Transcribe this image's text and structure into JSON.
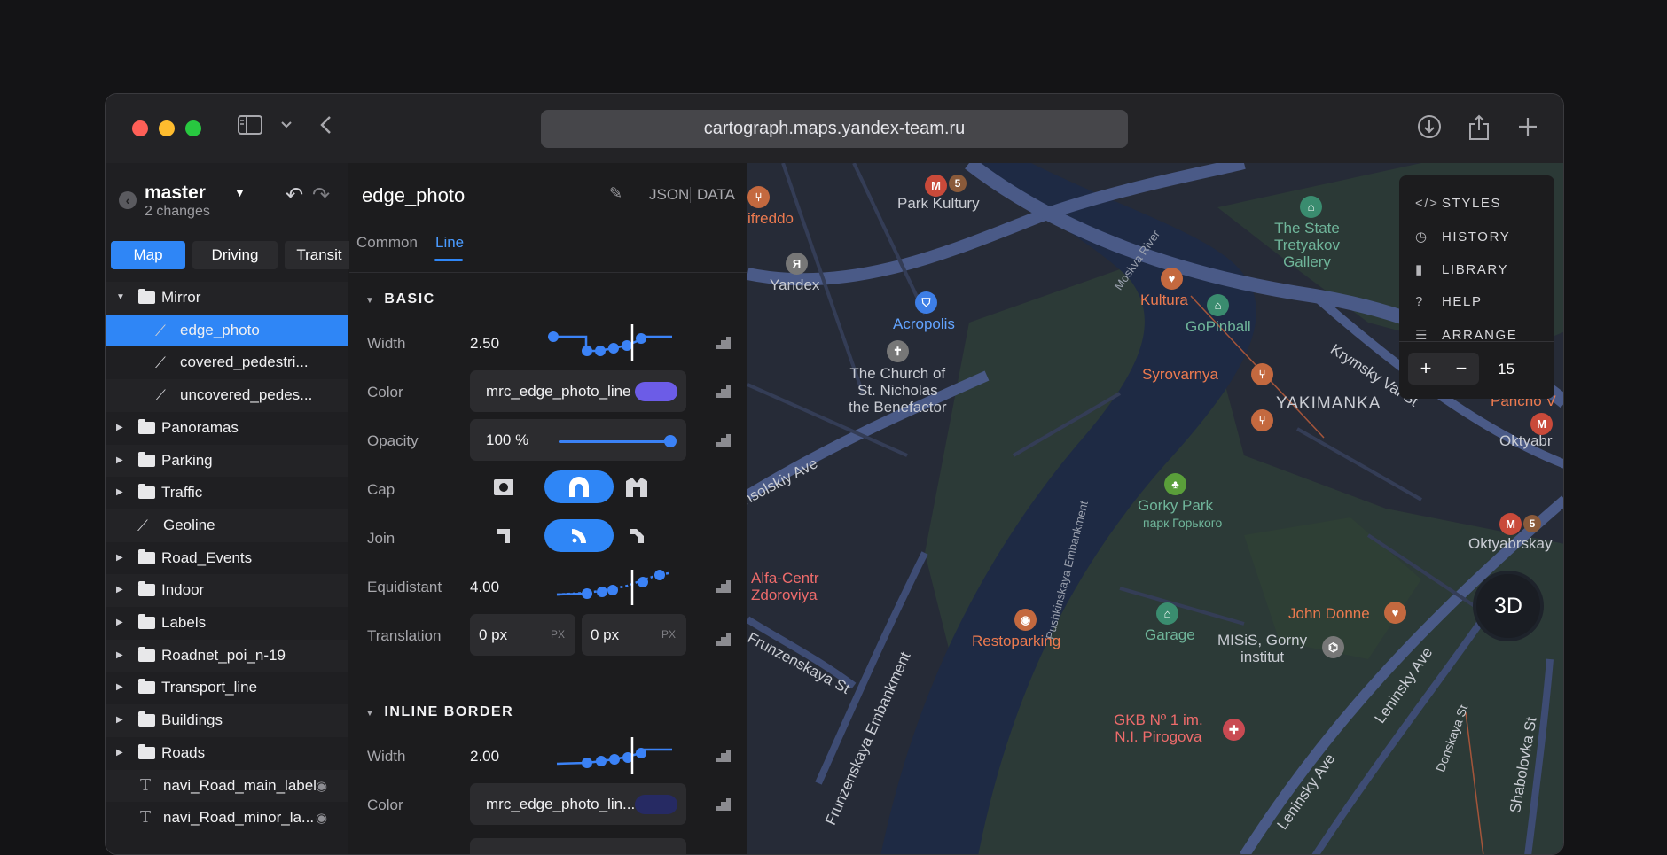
{
  "browser": {
    "url": "cartograph.maps.yandex-team.ru"
  },
  "sidebar": {
    "branch": "master",
    "changes": "2 changes",
    "tabs": [
      "Map",
      "Driving",
      "Transit"
    ],
    "layers": [
      {
        "label": "Mirror",
        "type": "folder"
      },
      {
        "label": "edge_photo",
        "type": "line"
      },
      {
        "label": "covered_pedestri...",
        "type": "line"
      },
      {
        "label": "uncovered_pedes...",
        "type": "line"
      },
      {
        "label": "Panoramas",
        "type": "folder"
      },
      {
        "label": "Parking",
        "type": "folder"
      },
      {
        "label": "Traffic",
        "type": "folder"
      },
      {
        "label": "Geoline",
        "type": "line"
      },
      {
        "label": "Road_Events",
        "type": "folder"
      },
      {
        "label": "Indoor",
        "type": "folder"
      },
      {
        "label": "Labels",
        "type": "folder"
      },
      {
        "label": "Roadnet_poi_n-19",
        "type": "folder"
      },
      {
        "label": "Transport_line",
        "type": "folder"
      },
      {
        "label": "Buildings",
        "type": "folder"
      },
      {
        "label": "Roads",
        "type": "folder"
      },
      {
        "label": "navi_Road_main_label",
        "type": "text"
      },
      {
        "label": "navi_Road_minor_la...",
        "type": "text"
      }
    ]
  },
  "editor": {
    "title": "edge_photo",
    "json_label": "JSON",
    "data_label": "DATA",
    "tabs": [
      "Common",
      "Line"
    ],
    "basic": {
      "heading": "BASIC",
      "width_label": "Width",
      "width_value": "2.50",
      "color_label": "Color",
      "color_value": "mrc_edge_photo_line",
      "color_swatch": "#6c5ce7",
      "opacity_label": "Opacity",
      "opacity_value": "100 %",
      "opacity_level": 1.0,
      "cap_label": "Cap",
      "join_label": "Join",
      "equidistant_label": "Equidistant",
      "equidistant_value": "4.00",
      "translation_label": "Translation",
      "translation_x": "0 px",
      "translation_y": "0 px",
      "unit": "PX"
    },
    "inline_border": {
      "heading": "INLINE BORDER",
      "width_label": "Width",
      "width_value": "2.00",
      "color_label": "Color",
      "color_value": "mrc_edge_photo_lin...",
      "color_swatch": "#262a63"
    }
  },
  "map": {
    "menu": [
      "STYLES",
      "HISTORY",
      "LIBRARY",
      "HELP",
      "ARRANGE"
    ],
    "zoom": "15",
    "button_3d": "3D",
    "labels": {
      "park_kultury": "Park Kultury",
      "metro5": "5",
      "metro_m": "M",
      "ifreddo": "ifreddo",
      "yandex": "Yandex",
      "acropolis": "Acropolis",
      "church": "The Church of\nSt. Nicholas\nthe Benefactor",
      "kultura": "Kultura",
      "gopinball": "GoPinball",
      "tretyakov": "The State\nTretyakov\nGallery",
      "syrovarnya": "Syrovarnya",
      "yakimanka": "YAKIMANKA",
      "gorky_park": "Gorky Park",
      "gorky_park_ru": "парк Горького",
      "pancho": "Pancho V",
      "oktyabr": "Oktyabr",
      "oktyabrskaya": "Oktyabrskay",
      "alfa": "Alfa-Centr\nZdoroviya",
      "restoparking": "Restoparking",
      "garage": "Garage",
      "john_donne": "John Donne",
      "misis": "MISiS, Gorny\ninstitut",
      "gkb": "GKB Nº 1 im.\nN.I. Pirogova",
      "moskva_river": "Moskva River",
      "krymsky_val": "Krymsky Val St",
      "pushkinskaya": "Pushkinskaya Embankment",
      "frunzenskaya_emb": "Frunzenskaya Embankment",
      "frunzenskaya_st": "Frunzenskaya St",
      "komsomolsky": "nsolskiy Ave",
      "leninsky": "Leninsky Ave",
      "leninsky_st": "Leninsky Ave",
      "donskaya": "Donskaya St",
      "shabolovka": "Shabolovka St"
    }
  }
}
